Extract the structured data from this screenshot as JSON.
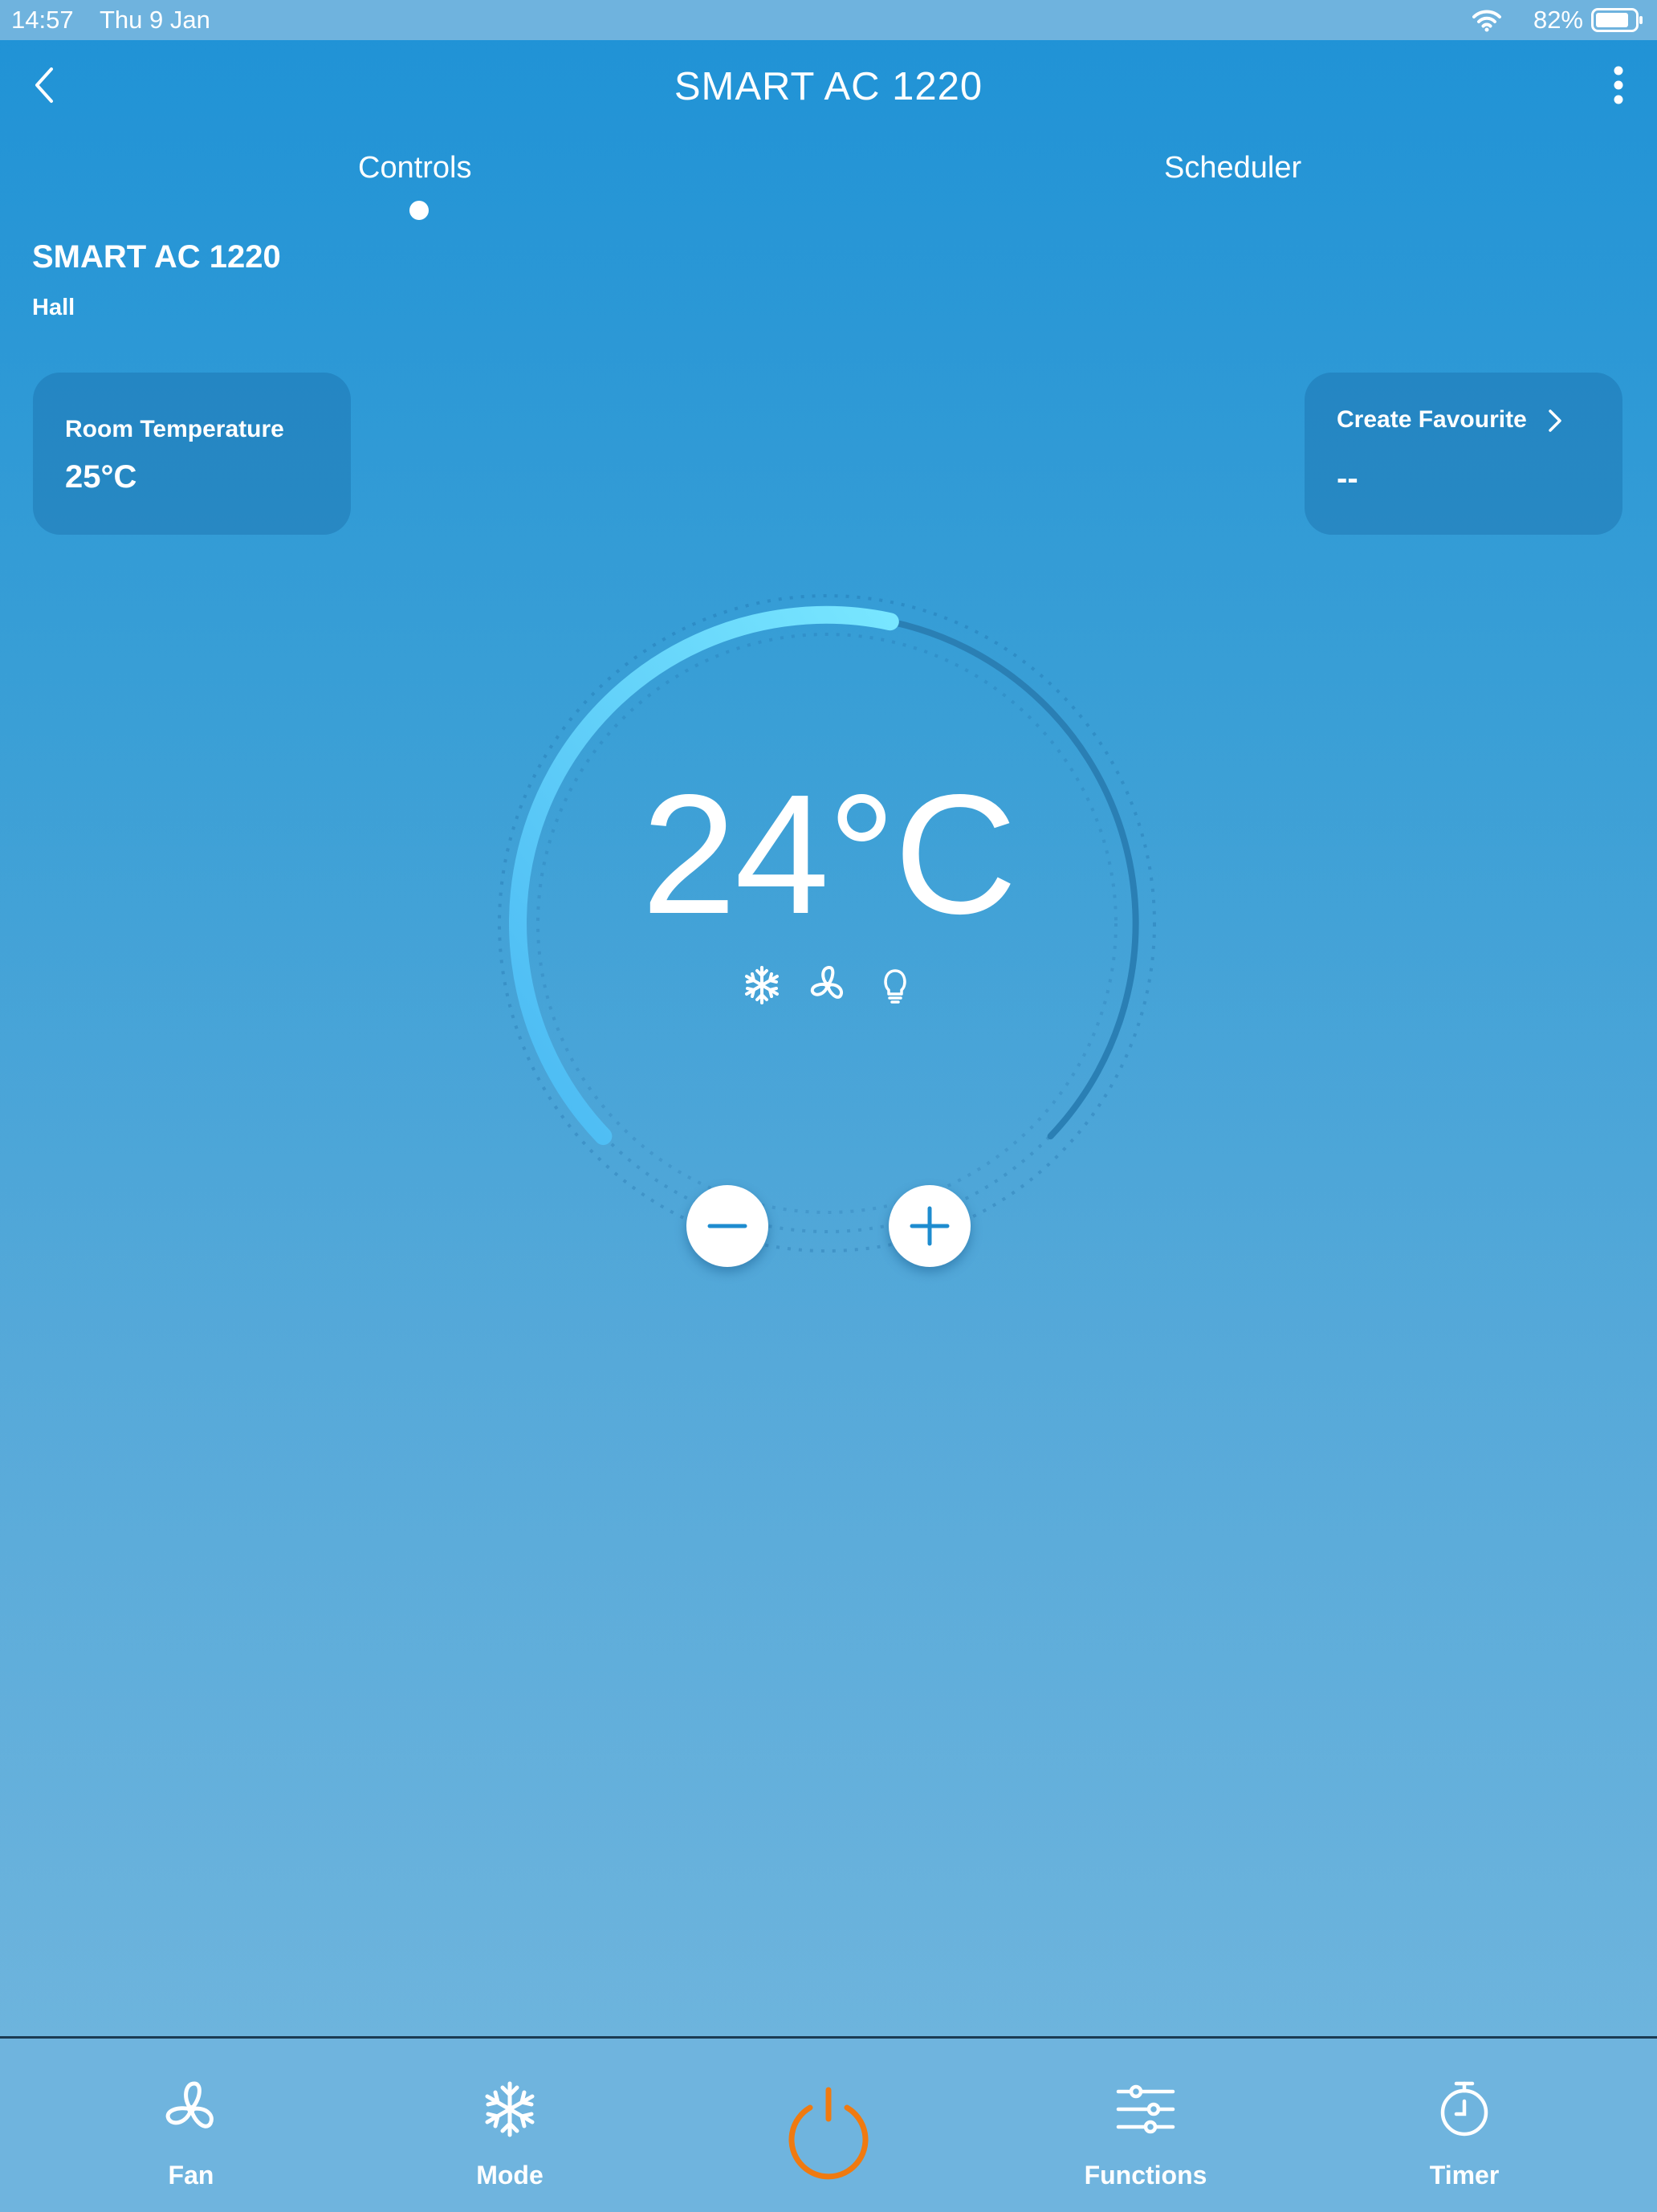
{
  "status_bar": {
    "time": "14:57",
    "date": "Thu 9 Jan",
    "battery": "82%"
  },
  "header": {
    "title": "SMART AC 1220",
    "back_icon": "chevron-left-icon",
    "more_icon": "more-vertical-icon"
  },
  "tabs": [
    {
      "label": "Controls",
      "active": true
    },
    {
      "label": "Scheduler",
      "active": false
    }
  ],
  "device": {
    "name": "SMART AC 1220",
    "room": "Hall"
  },
  "room_card": {
    "label": "Room Temperature",
    "value": "25°C"
  },
  "favourite_card": {
    "label": "Create Favourite",
    "value": "--"
  },
  "dial": {
    "set_temperature": "24°C",
    "status_icons": [
      "snowflake-icon",
      "fan-icon",
      "bulb-icon"
    ]
  },
  "bottom_bar": {
    "items": [
      {
        "label": "Fan",
        "icon": "fan-icon"
      },
      {
        "label": "Mode",
        "icon": "snowflake-icon"
      },
      {
        "label": "",
        "icon": "power-icon"
      },
      {
        "label": "Functions",
        "icon": "sliders-icon"
      },
      {
        "label": "Timer",
        "icon": "timer-icon"
      }
    ]
  },
  "colors": {
    "background_top": "#1f92d6",
    "background_bottom": "#6db4dd",
    "arc_active": "#6ee3ff",
    "arc_inactive": "#2a7fb4",
    "power_accent": "#f07a10",
    "bottom_bar": "#6fb4de"
  }
}
